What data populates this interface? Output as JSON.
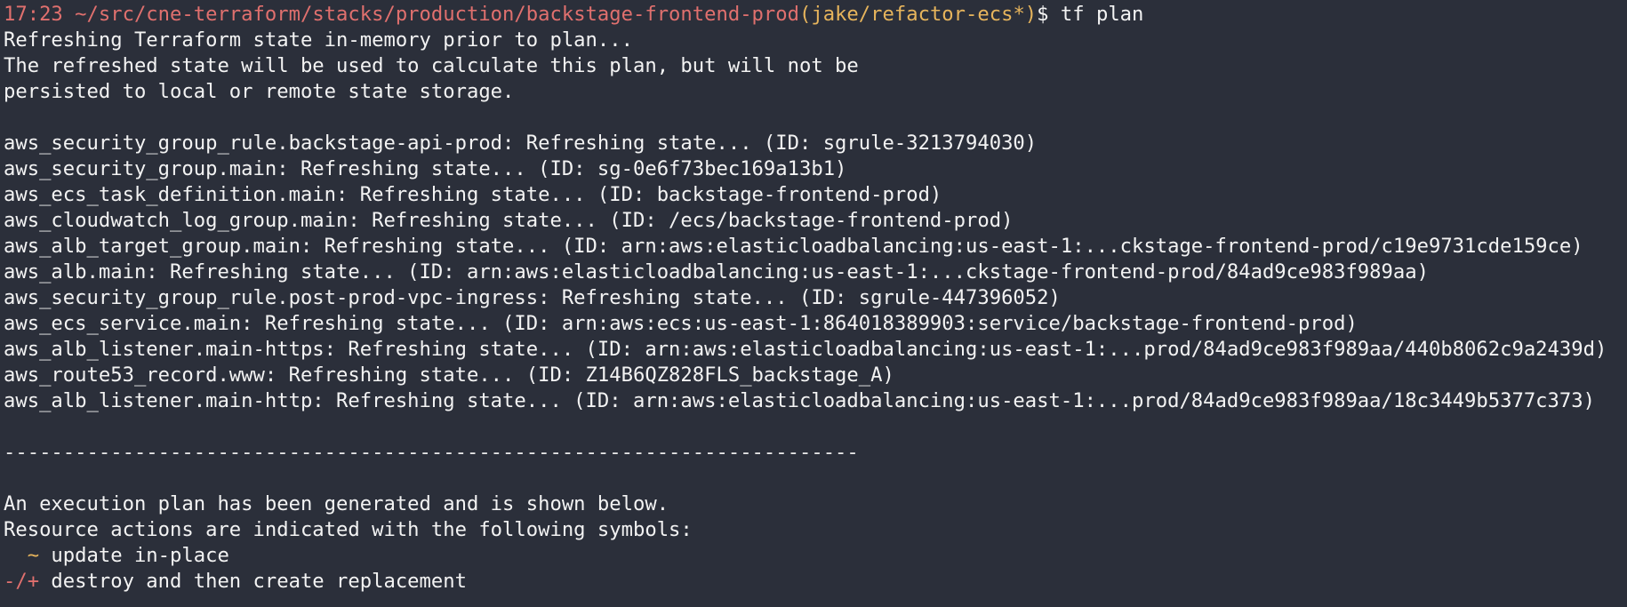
{
  "prompt": {
    "time": "17:23",
    "path": "~/src/cne-terraform/stacks/production/backstage-frontend-prod",
    "branch": "(jake/refactor-ecs*)",
    "dollar": "$",
    "command": "tf plan"
  },
  "intro": [
    "Refreshing Terraform state in-memory prior to plan...",
    "The refreshed state will be used to calculate this plan, but will not be",
    "persisted to local or remote state storage."
  ],
  "refresh_lines": [
    "aws_security_group_rule.backstage-api-prod: Refreshing state... (ID: sgrule-3213794030)",
    "aws_security_group.main: Refreshing state... (ID: sg-0e6f73bec169a13b1)",
    "aws_ecs_task_definition.main: Refreshing state... (ID: backstage-frontend-prod)",
    "aws_cloudwatch_log_group.main: Refreshing state... (ID: /ecs/backstage-frontend-prod)",
    "aws_alb_target_group.main: Refreshing state... (ID: arn:aws:elasticloadbalancing:us-east-1:...ckstage-frontend-prod/c19e9731cde159ce)",
    "aws_alb.main: Refreshing state... (ID: arn:aws:elasticloadbalancing:us-east-1:...ckstage-frontend-prod/84ad9ce983f989aa)",
    "aws_security_group_rule.post-prod-vpc-ingress: Refreshing state... (ID: sgrule-447396052)",
    "aws_ecs_service.main: Refreshing state... (ID: arn:aws:ecs:us-east-1:864018389903:service/backstage-frontend-prod)",
    "aws_alb_listener.main-https: Refreshing state... (ID: arn:aws:elasticloadbalancing:us-east-1:...prod/84ad9ce983f989aa/440b8062c9a2439d)",
    "aws_route53_record.www: Refreshing state... (ID: Z14B6QZ828FLS_backstage_A)",
    "aws_alb_listener.main-http: Refreshing state... (ID: arn:aws:elasticloadbalancing:us-east-1:...prod/84ad9ce983f989aa/18c3449b5377c373)"
  ],
  "divider": "------------------------------------------------------------------------",
  "plan": {
    "line1": "An execution plan has been generated and is shown below.",
    "line2": "Resource actions are indicated with the following symbols:",
    "update_symbol": "  ~",
    "update_text": " update in-place",
    "replace_symbol": "-/+",
    "replace_text": " destroy and then create replacement"
  },
  "colors": {
    "background": "#2b2f3a",
    "text": "#f3f3f3",
    "red": "#e0706e",
    "yellow": "#e6b45c"
  }
}
